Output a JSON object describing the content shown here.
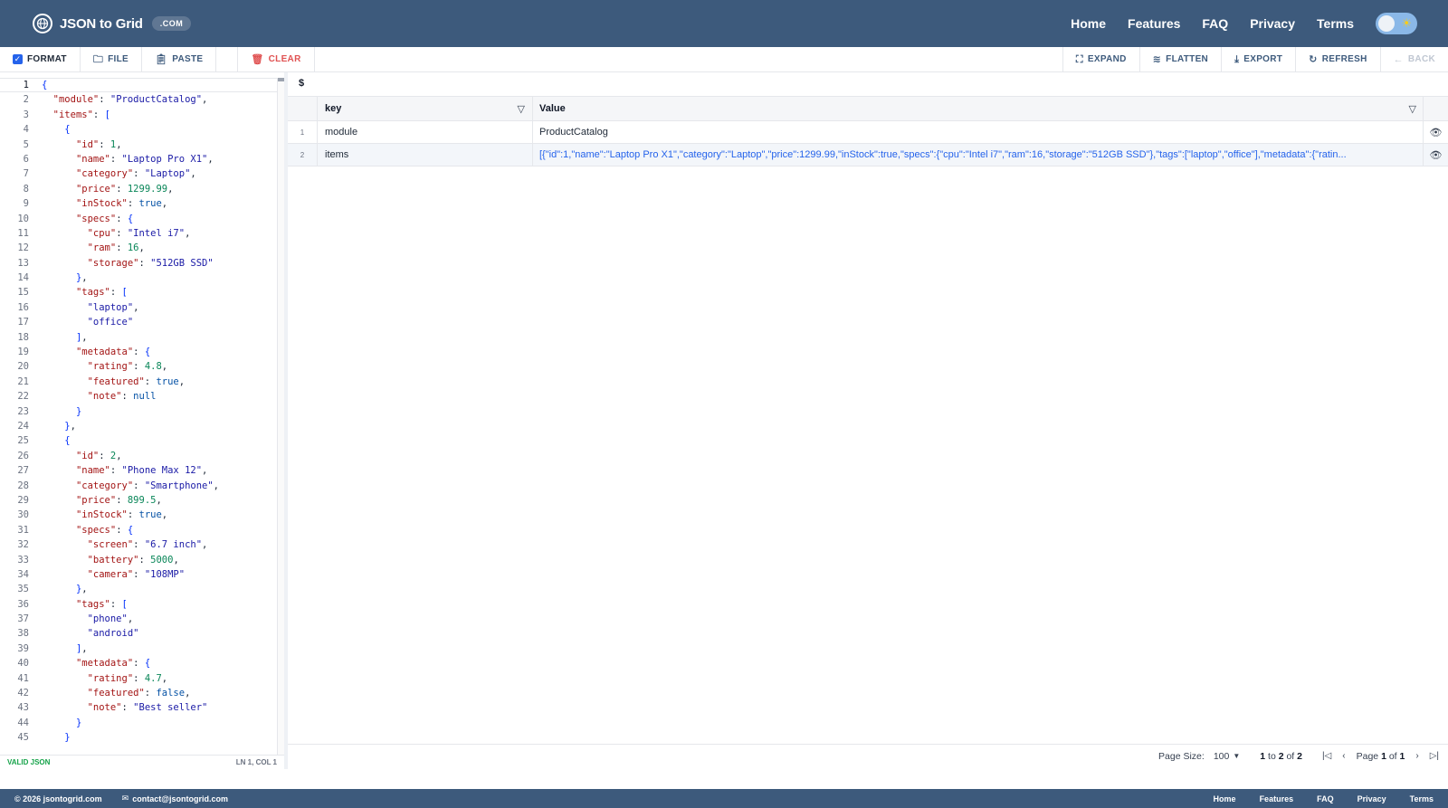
{
  "app": {
    "brand_name": "JSON to Grid",
    "brand_badge": ".COM",
    "nav": [
      "Home",
      "Features",
      "FAQ",
      "Privacy",
      "Terms"
    ]
  },
  "toolbar": {
    "format_label": "FORMAT",
    "file_label": "FILE",
    "paste_label": "PASTE",
    "clear_label": "CLEAR",
    "expand_label": "EXPAND",
    "flatten_label": "FLATTEN",
    "export_label": "EXPORT",
    "refresh_label": "REFRESH",
    "back_label": "BACK"
  },
  "editor": {
    "lines": [
      "{",
      "  \"module\": \"ProductCatalog\",",
      "  \"items\": [",
      "    {",
      "      \"id\": 1,",
      "      \"name\": \"Laptop Pro X1\",",
      "      \"category\": \"Laptop\",",
      "      \"price\": 1299.99,",
      "      \"inStock\": true,",
      "      \"specs\": {",
      "        \"cpu\": \"Intel i7\",",
      "        \"ram\": 16,",
      "        \"storage\": \"512GB SSD\"",
      "      },",
      "      \"tags\": [",
      "        \"laptop\",",
      "        \"office\"",
      "      ],",
      "      \"metadata\": {",
      "        \"rating\": 4.8,",
      "        \"featured\": true,",
      "        \"note\": null",
      "      }",
      "    },",
      "    {",
      "      \"id\": 2,",
      "      \"name\": \"Phone Max 12\",",
      "      \"category\": \"Smartphone\",",
      "      \"price\": 899.5,",
      "      \"inStock\": true,",
      "      \"specs\": {",
      "        \"screen\": \"6.7 inch\",",
      "        \"battery\": 5000,",
      "        \"camera\": \"108MP\"",
      "      },",
      "      \"tags\": [",
      "        \"phone\",",
      "        \"android\"",
      "      ],",
      "      \"metadata\": {",
      "        \"rating\": 4.7,",
      "        \"featured\": false,",
      "        \"note\": \"Best seller\"",
      "      }",
      "    }"
    ],
    "status_valid": "VALID JSON",
    "cursor_position": "LN 1, COL 1"
  },
  "grid": {
    "path": "$",
    "columns": {
      "key": "key",
      "value": "Value"
    },
    "rows": [
      {
        "index": "1",
        "key": "module",
        "value": "ProductCatalog",
        "is_object": false
      },
      {
        "index": "2",
        "key": "items",
        "value": "[{\"id\":1,\"name\":\"Laptop Pro X1\",\"category\":\"Laptop\",\"price\":1299.99,\"inStock\":true,\"specs\":{\"cpu\":\"Intel i7\",\"ram\":16,\"storage\":\"512GB SSD\"},\"tags\":[\"laptop\",\"office\"],\"metadata\":{\"ratin...",
        "is_object": true
      }
    ],
    "pagination": {
      "page_size_label": "Page Size:",
      "page_size": "100",
      "range_from": "1",
      "range_to": "2",
      "total": "2",
      "page_current": "1",
      "page_total": "1"
    }
  },
  "footer": {
    "copyright": "© 2026 jsontogrid.com",
    "email": "contact@jsontogrid.com",
    "links": [
      "Home",
      "Features",
      "FAQ",
      "Privacy",
      "Terms"
    ]
  }
}
